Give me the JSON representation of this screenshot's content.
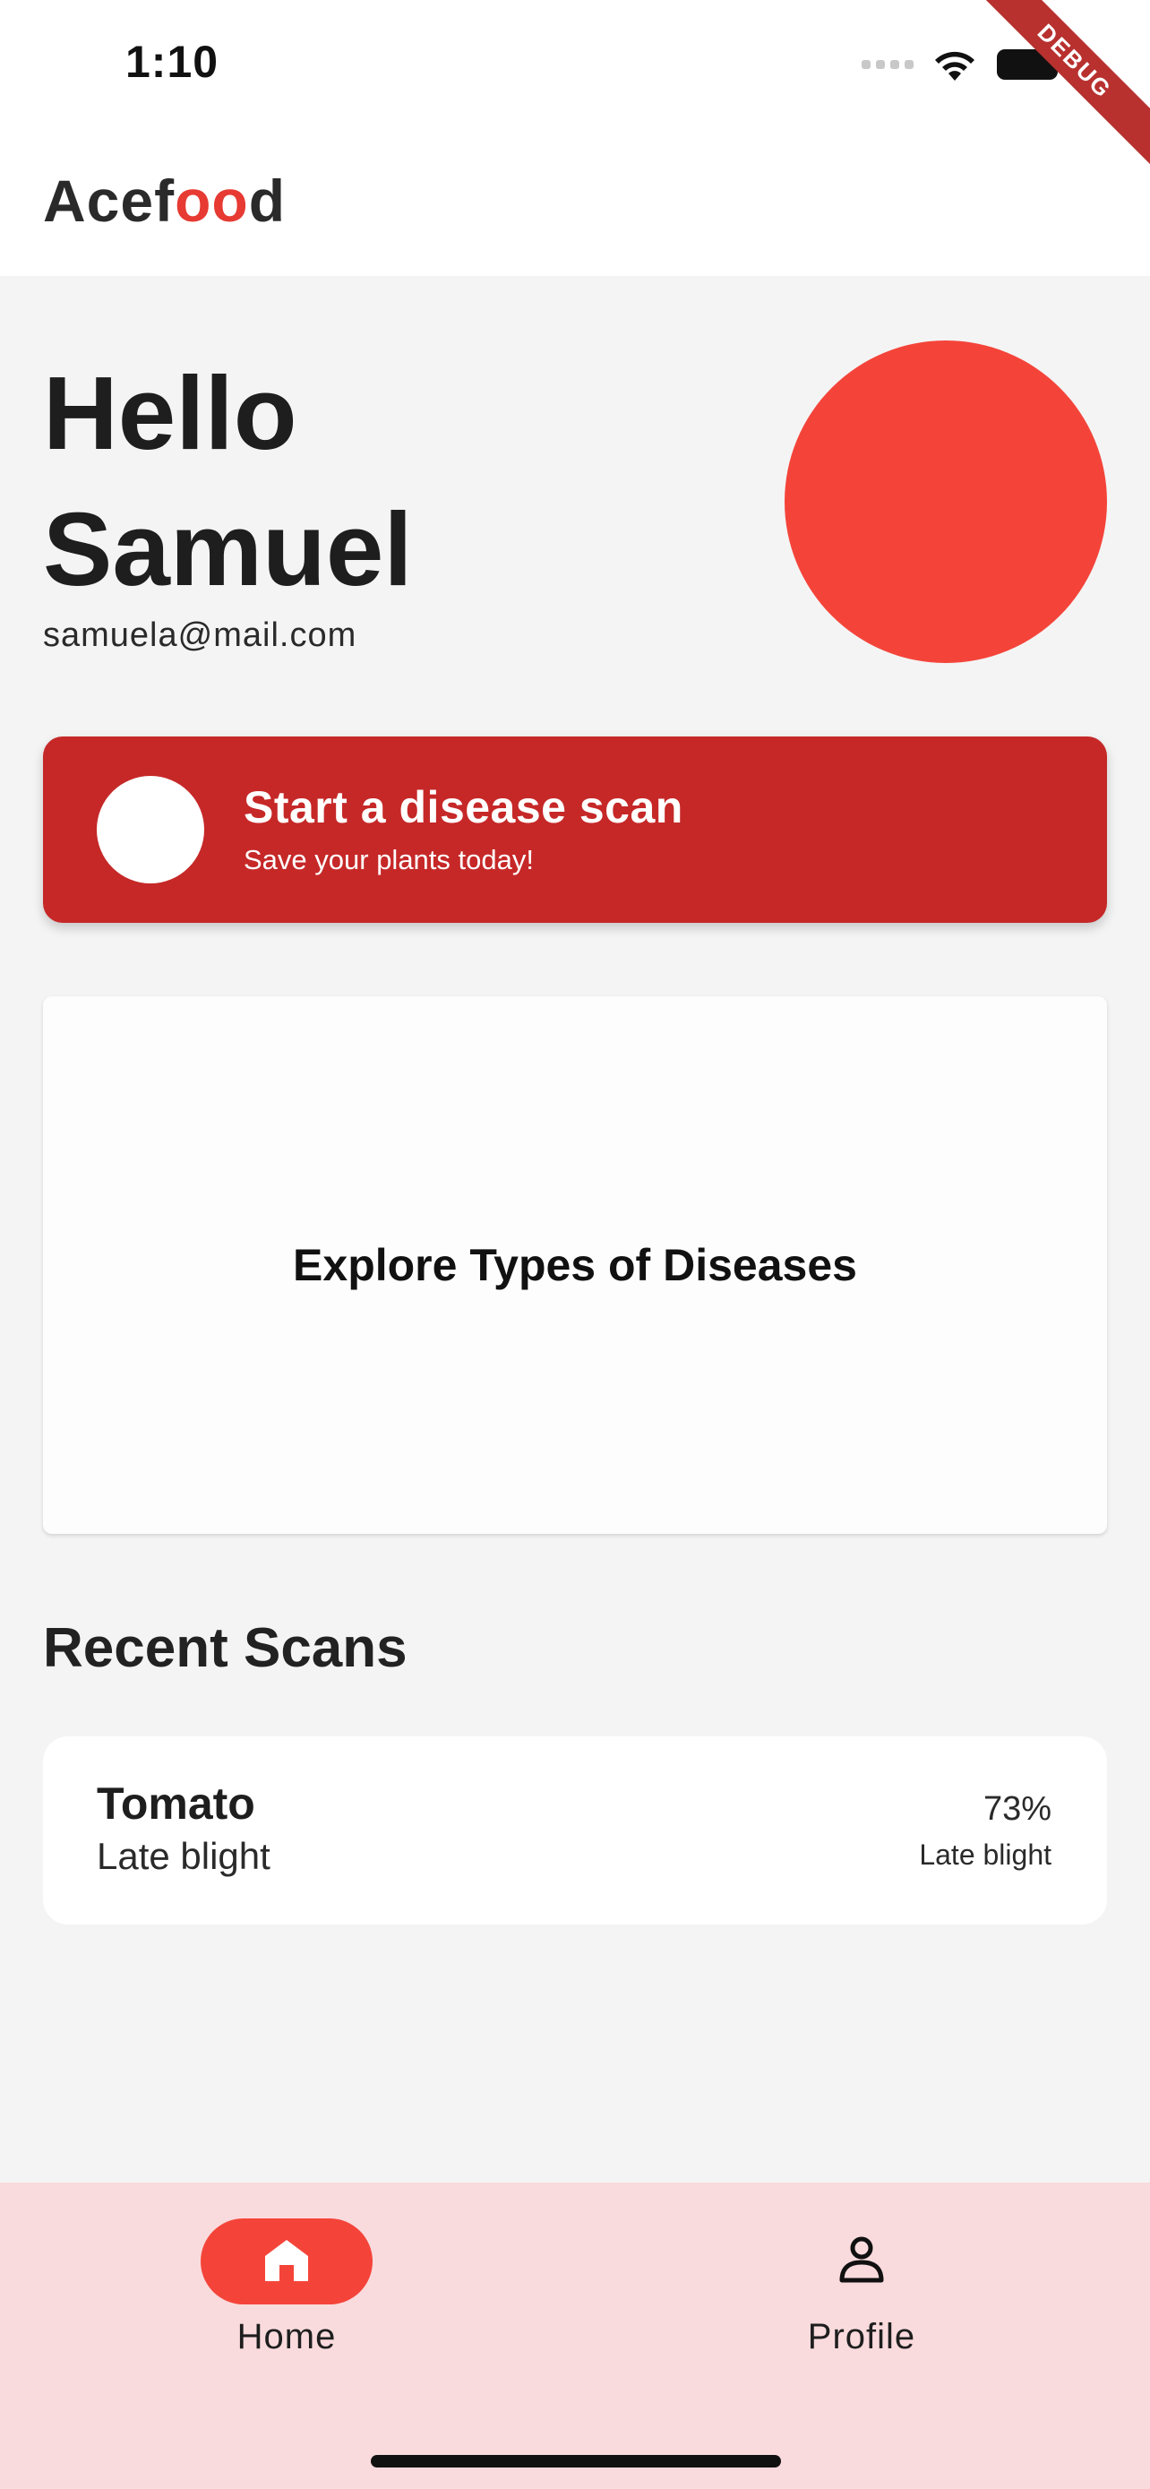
{
  "status_bar": {
    "time": "1:10",
    "debug_label": "DEBUG"
  },
  "app_bar": {
    "logo_prefix": "Acef",
    "logo_accent": "oo",
    "logo_suffix": "d"
  },
  "greeting": {
    "hello": "Hello",
    "name": "Samuel",
    "email": "samuela@mail.com"
  },
  "scan_card": {
    "title": "Start a disease scan",
    "subtitle": "Save your plants today!"
  },
  "explore": {
    "title": "Explore Types of Diseases"
  },
  "recent": {
    "heading": "Recent Scans",
    "items": [
      {
        "plant": "Tomato",
        "disease": "Late blight",
        "confidence": "73%",
        "disease_right": "Late blight"
      }
    ]
  },
  "nav": {
    "home_label": "Home",
    "profile_label": "Profile"
  },
  "colors": {
    "accent": "#f4443a",
    "scan_card": "#c62828",
    "nav_bg": "#fadbdd",
    "background": "#f4f4f4"
  },
  "icons": {
    "home": "home-icon",
    "profile": "person-icon",
    "wifi": "wifi-icon",
    "battery": "battery-icon"
  }
}
